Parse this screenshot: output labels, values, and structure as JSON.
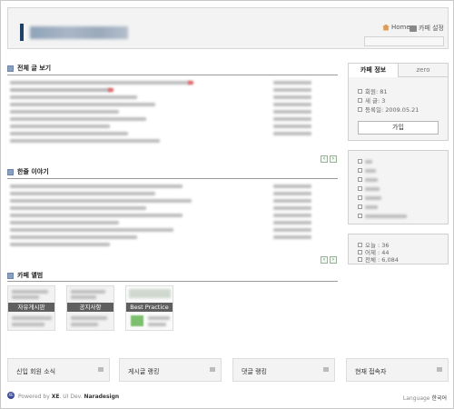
{
  "header": {
    "home_label": "Home",
    "settings_label": "카페 설정"
  },
  "sections": {
    "all_posts": "전체 글 보기",
    "one_line": "한줄 이야기",
    "gallery": "카페 앨범"
  },
  "pager": {
    "prev": "‹",
    "next": "›"
  },
  "gallery": [
    {
      "label": "자유게시판"
    },
    {
      "label": "공지사항"
    },
    {
      "label": "Best Practice"
    }
  ],
  "sidebar": {
    "tab_info": "카페 정보",
    "tab_zero": "zero",
    "members": "회원: 81",
    "new_posts": "새 글: 3",
    "registered": "등록일: 2009.05.21",
    "join_button": "가입",
    "visits": {
      "today": "오늘 : 36",
      "yesterday": "어제 : 44",
      "total": "전체 : 6,084"
    }
  },
  "bottom": {
    "new_members": "신입 회원 소식",
    "post_rank": "게시글 랭킹",
    "comment_rank": "댓글 랭킹",
    "online_users": "현재 접속자"
  },
  "footer": {
    "powered": "Powered by",
    "xe": "XE",
    "dev": ". UI Dev.",
    "naradesign": "Naradesign",
    "language_label": "Language",
    "language_value": "한국어"
  }
}
